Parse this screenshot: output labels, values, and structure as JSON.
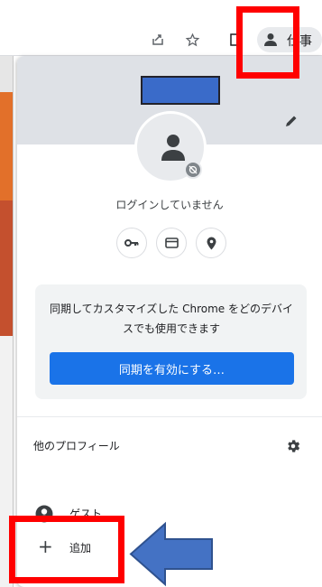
{
  "toolbar": {
    "icons": [
      "share-icon",
      "star-icon",
      "side-panel-icon"
    ],
    "profile_chip_label": "仕事"
  },
  "profile_menu": {
    "status_text": "ログインしていません",
    "quick_actions": [
      "key-icon",
      "credit-card-icon",
      "location-icon"
    ],
    "sync_card": {
      "message": "同期してカスタマイズした Chrome をどのデバイスでも使用できます",
      "button_label": "同期を有効にする…"
    },
    "other_profiles_label": "他のプロフィール",
    "guest_label": "ゲスト",
    "add_label": "追加"
  },
  "colors": {
    "accent_blue": "#1a73e8",
    "header_gray": "#dee1e6",
    "annotation_red": "#ff0000",
    "annotation_arrow_blue": "#4472c4",
    "blurred_box_blue": "#3a6bc9"
  }
}
